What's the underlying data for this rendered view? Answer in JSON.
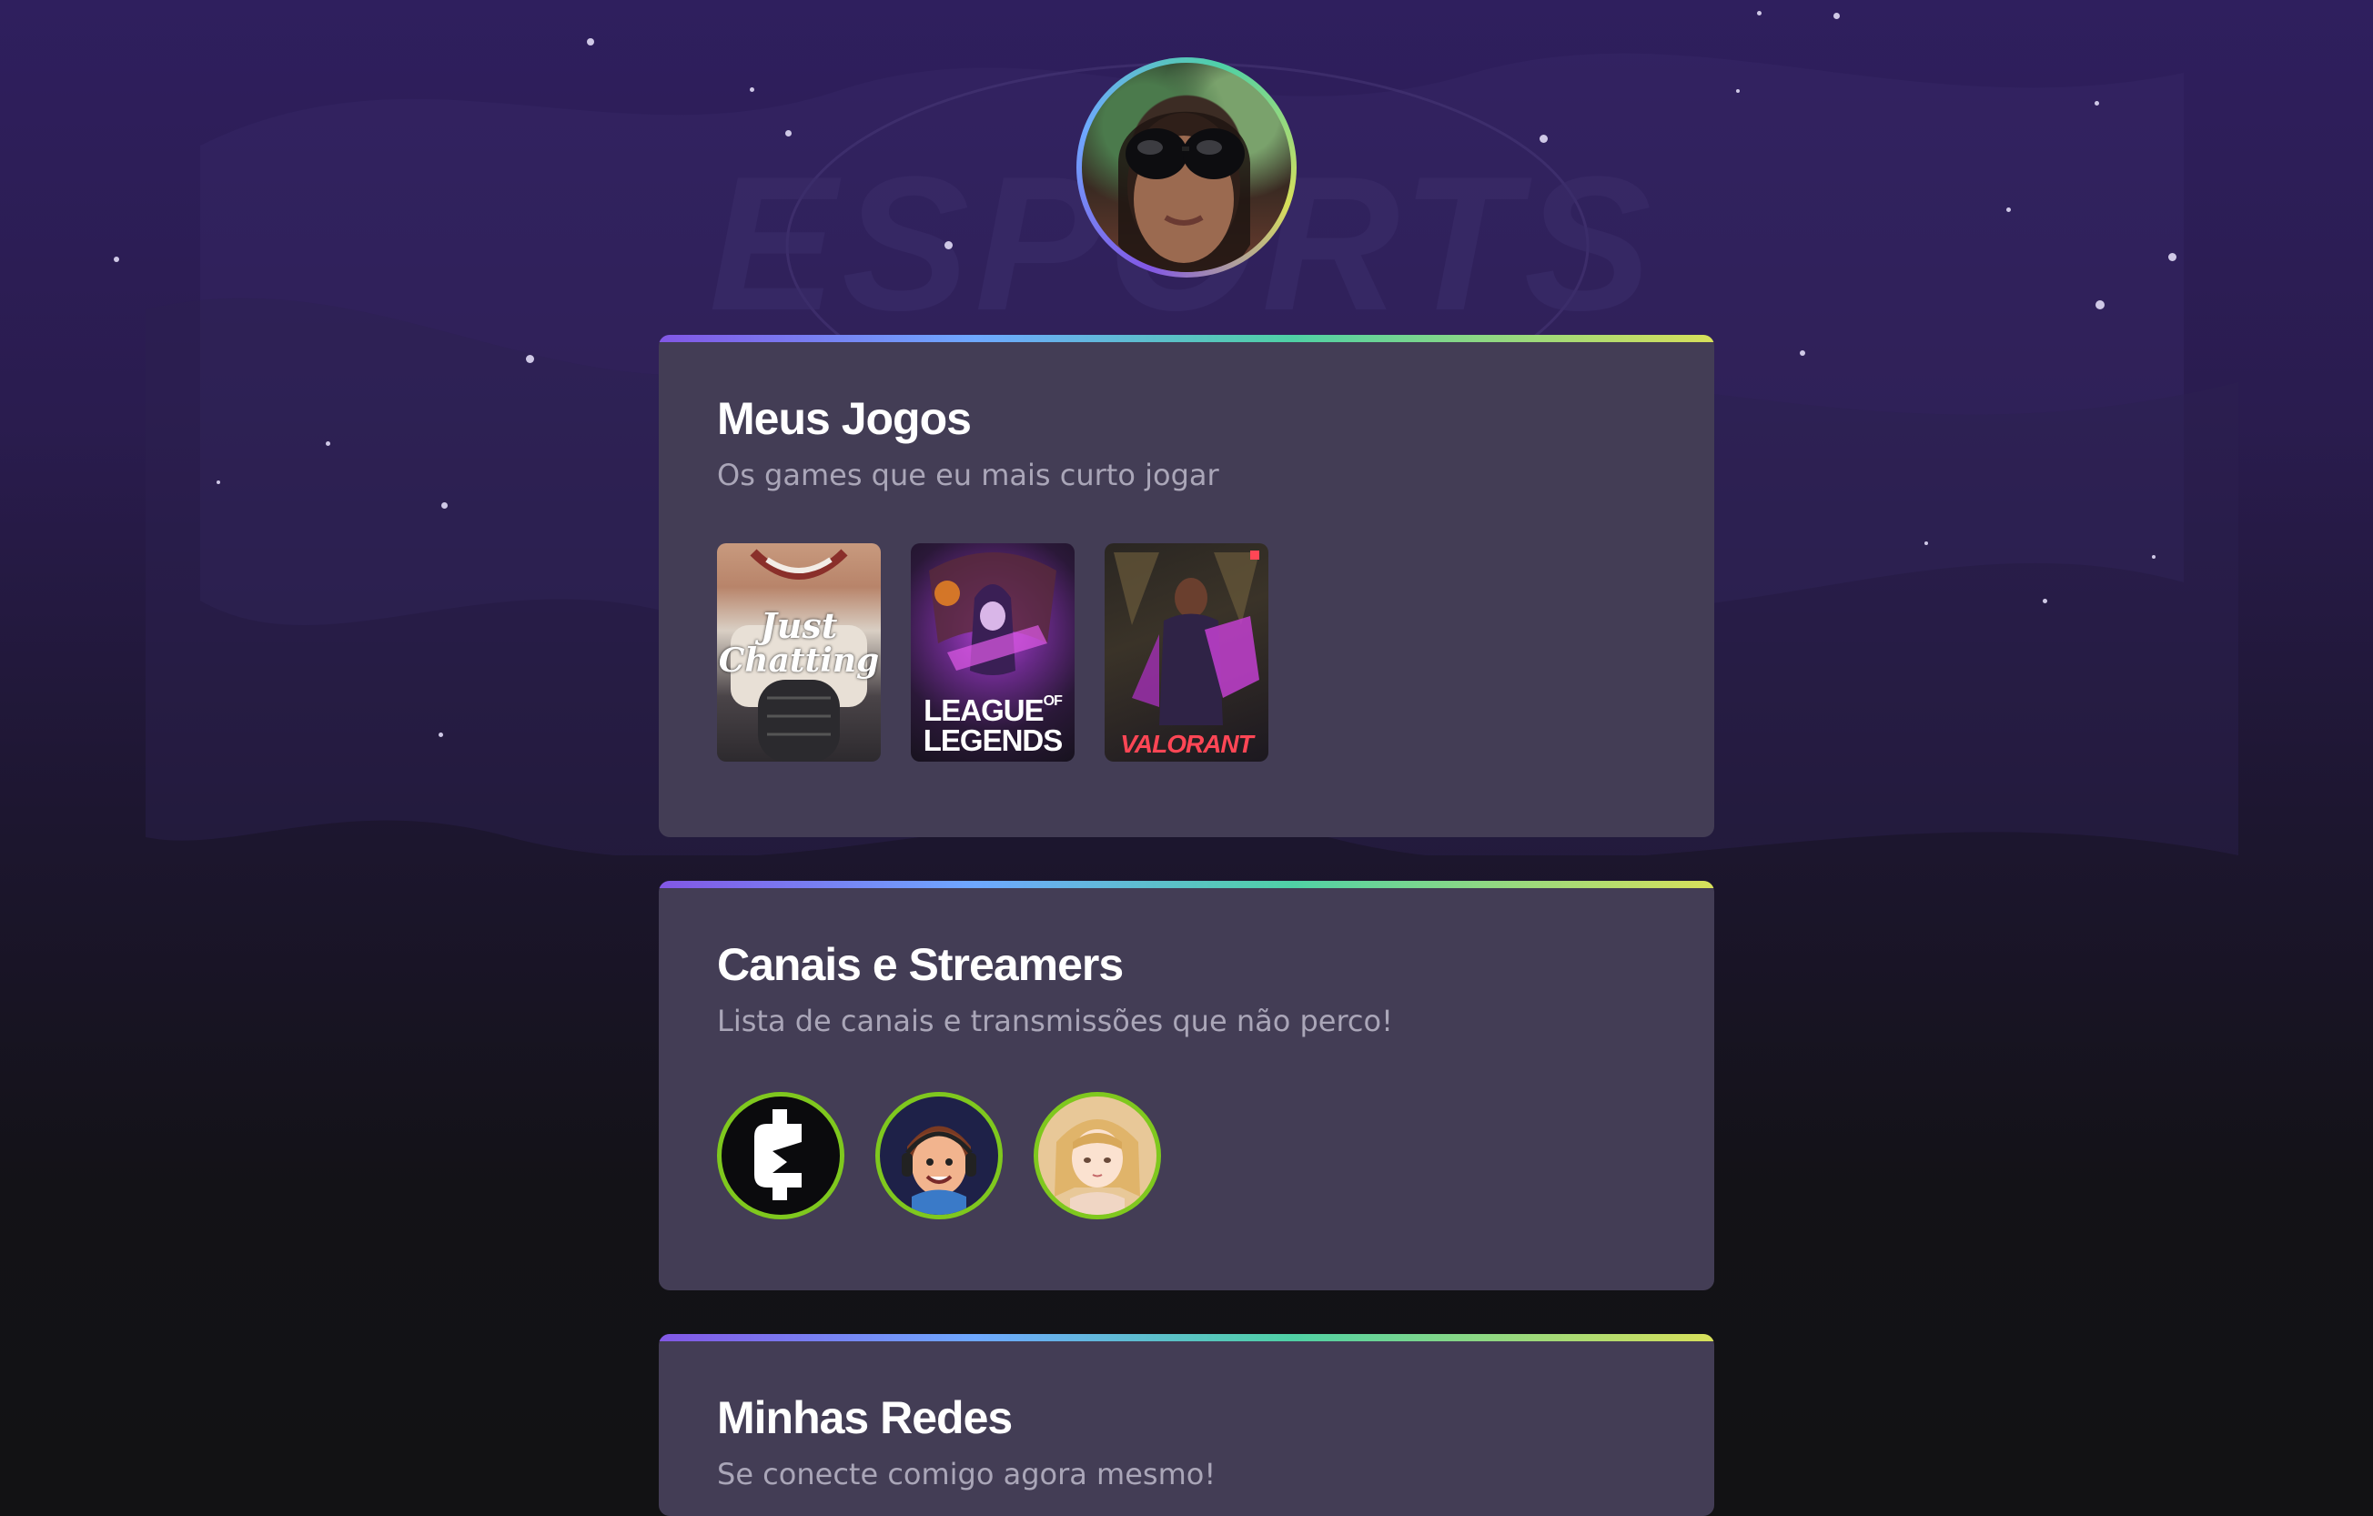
{
  "profile": {
    "avatar_icon": "profile-photo"
  },
  "colors": {
    "background_top": "#2f1f5e",
    "background_bottom": "#121214",
    "card": "#433d55",
    "accent_gradient": [
      "#8257e5",
      "#6ea8ff",
      "#4fd1a5",
      "#d8e05a"
    ],
    "streamer_ring": "#7fc81e"
  },
  "sections": {
    "games": {
      "title": "Meus Jogos",
      "subtitle": "Os games que eu mais curto jogar",
      "items": [
        {
          "name": "Just Chatting",
          "line1": "Just",
          "line2": "Chatting"
        },
        {
          "name": "League of Legends",
          "line1": "LEAGUE",
          "line1_sup": "OF",
          "line2": "LEGENDS"
        },
        {
          "name": "Valorant",
          "label": "VALORANT"
        }
      ]
    },
    "streamers": {
      "title": "Canais e Streamers",
      "subtitle": "Lista de canais e transmissões que não perco!",
      "items": [
        {
          "icon": "channel-logo-c"
        },
        {
          "icon": "streamer-cartoon-headset"
        },
        {
          "icon": "streamer-anime-girl"
        }
      ]
    },
    "socials": {
      "title": "Minhas Redes",
      "subtitle": "Se conecte comigo agora mesmo!"
    }
  }
}
